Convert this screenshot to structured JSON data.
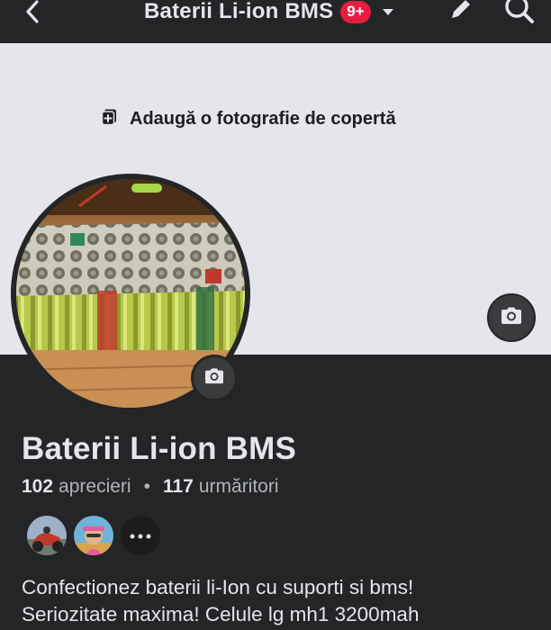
{
  "header": {
    "title": "Baterii Li-ion BMS",
    "notification_badge": "9+",
    "icons": {
      "back": "chevron-left-icon",
      "dropdown": "caret-down-icon",
      "edit": "pencil-icon",
      "search": "search-icon"
    }
  },
  "cover": {
    "add_label": "Adaugă o fotografie de copertă",
    "background_color": "#e4e6eb"
  },
  "profile": {
    "name": "Baterii Li-ion BMS",
    "likes_count": "102",
    "likes_label": "aprecieri",
    "separator": "•",
    "followers_count": "117",
    "followers_label": "urmăritori",
    "bio_line1": "Confectionez baterii li-Ion cu suporti si bms!",
    "bio_line2": "Seriozitate maxima! Celule lg mh1 3200mah"
  },
  "colors": {
    "background": "#242526",
    "text_primary": "#e4e6eb",
    "text_secondary": "#b0b3b8",
    "badge": "#e41e3f",
    "icon_button": "#3a3b3c"
  }
}
